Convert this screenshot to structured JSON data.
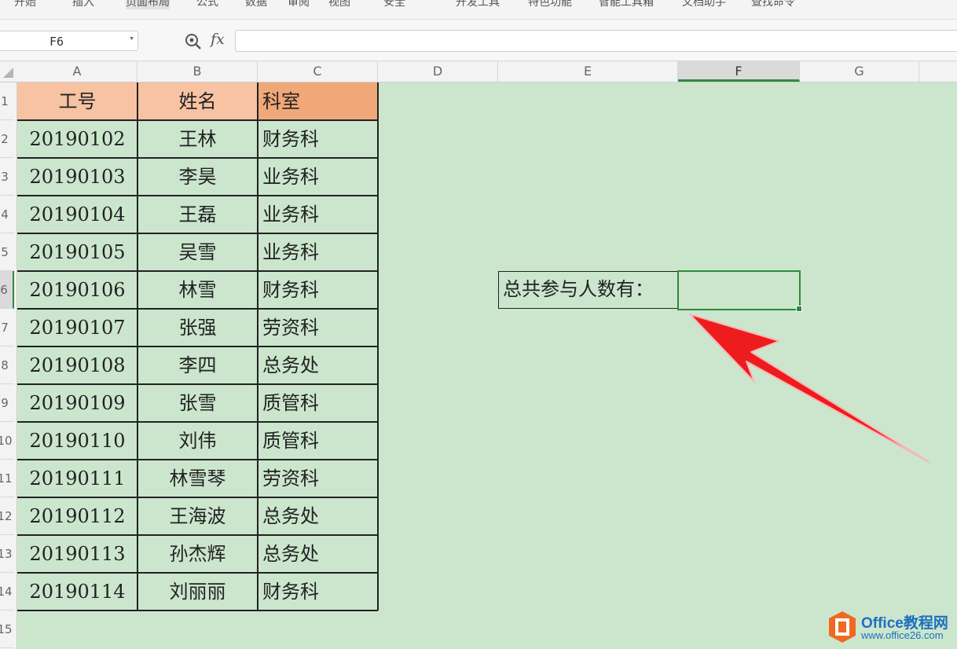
{
  "ribbon": {
    "tabs": [
      "开始",
      "插入",
      "页面布局",
      "公式",
      "数据",
      "审阅",
      "视图",
      "安全",
      "开发工具",
      "特色功能",
      "智能工具箱",
      "文档助手",
      "查找命令"
    ]
  },
  "formula_bar": {
    "cell_ref": "F6",
    "fx_label": "fx",
    "formula": ""
  },
  "columns": [
    "A",
    "B",
    "C",
    "D",
    "E",
    "F",
    "G"
  ],
  "rows": [
    "1",
    "2",
    "3",
    "4",
    "5",
    "6",
    "7",
    "8",
    "9",
    "10",
    "11",
    "12",
    "13",
    "14",
    "15"
  ],
  "table": {
    "headers": [
      "工号",
      "姓名",
      "科室"
    ],
    "rows": [
      [
        "20190102",
        "王林",
        "财务科"
      ],
      [
        "20190103",
        "李昊",
        "业务科"
      ],
      [
        "20190104",
        "王磊",
        "业务科"
      ],
      [
        "20190105",
        "吴雪",
        "业务科"
      ],
      [
        "20190106",
        "林雪",
        "财务科"
      ],
      [
        "20190107",
        "张强",
        "劳资科"
      ],
      [
        "20190108",
        "李四",
        "总务处"
      ],
      [
        "20190109",
        "张雪",
        "质管科"
      ],
      [
        "20190110",
        "刘伟",
        "质管科"
      ],
      [
        "20190111",
        "林雪琴",
        "劳资科"
      ],
      [
        "20190112",
        "王海波",
        "总务处"
      ],
      [
        "20190113",
        "孙杰辉",
        "总务处"
      ],
      [
        "20190114",
        "刘丽丽",
        "财务科"
      ]
    ]
  },
  "summary": {
    "label": "总共参与人数有：",
    "value": ""
  },
  "selected_cell": "F6",
  "colors": {
    "sheet_background": "#cbe6cd",
    "header_fill_light": "#f7c3a3",
    "header_fill_dark": "#f0a878",
    "selection": "#2f8a3a",
    "arrow": "#ee1c1c"
  },
  "watermark": {
    "brand": "Office教程网",
    "url": "www.office26.com"
  }
}
